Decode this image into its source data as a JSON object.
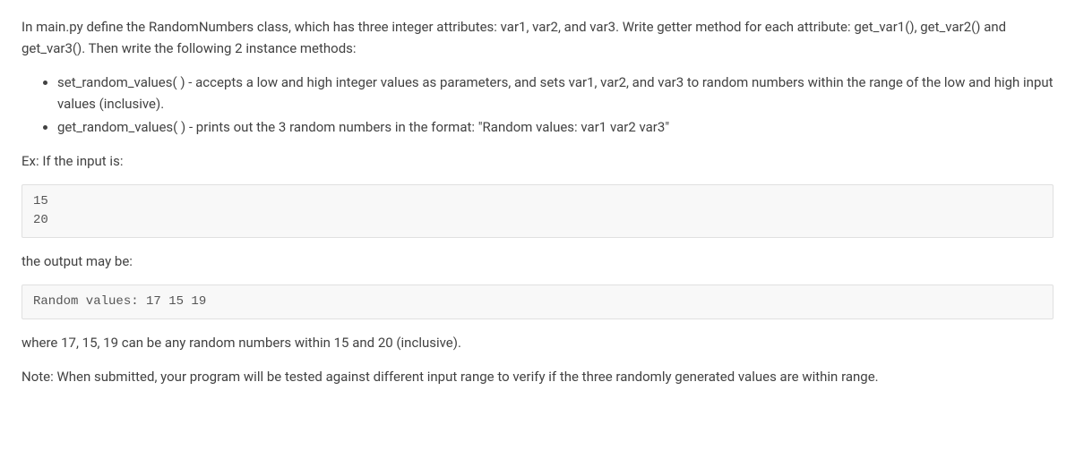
{
  "intro": {
    "part1": "In main.py define the RandomNumbers class, which has three integer attributes: var1, var2, and var3. Write getter method for each attribute: get_var1(), get_var2() and get_var3(). Then write the following 2 instance methods:"
  },
  "bullets": [
    "set_random_values( ) - accepts a low and high integer values as parameters, and sets var1, var2, and var3 to random numbers within the range of the low and high input values (inclusive).",
    "get_random_values( ) - prints out the 3 random numbers in the format: \"Random values: var1 var2 var3\""
  ],
  "example_label": "Ex: If the input is:",
  "input_block": "15\n20",
  "output_label": "the output may be:",
  "output_block": "Random values: 17 15 19",
  "explanation": "where 17, 15, 19 can be any random numbers within 15 and 20 (inclusive).",
  "note": "Note: When submitted, your program will be tested against different input range to verify if the three randomly generated values are within range."
}
